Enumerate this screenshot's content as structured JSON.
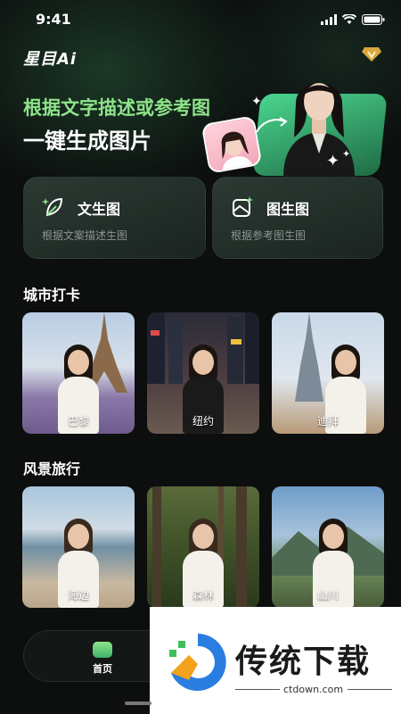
{
  "status": {
    "time": "9:41"
  },
  "app": {
    "logo": "星目Ai"
  },
  "hero": {
    "line1": "根据文字描述或参考图",
    "line2": "一键生成图片"
  },
  "modes": [
    {
      "title": "文生图",
      "subtitle": "根据文案描述生图",
      "icon": "leaf-pen-icon"
    },
    {
      "title": "图生图",
      "subtitle": "根据参考图生图",
      "icon": "image-sparkle-icon"
    }
  ],
  "sections": [
    {
      "title": "城市打卡",
      "items": [
        {
          "label": "巴黎"
        },
        {
          "label": "纽约"
        },
        {
          "label": "迪拜"
        }
      ]
    },
    {
      "title": "风景旅行",
      "items": [
        {
          "label": "海边"
        },
        {
          "label": "森林"
        },
        {
          "label": "山川"
        }
      ]
    }
  ],
  "tabbar": {
    "home_label": "首页"
  },
  "watermark": {
    "brand": "传统下载",
    "url": "ctdown.com"
  },
  "colors": {
    "accent": "#8ee38a",
    "card_bg": "#1f2a25",
    "page_bg": "#0c0f0e"
  }
}
